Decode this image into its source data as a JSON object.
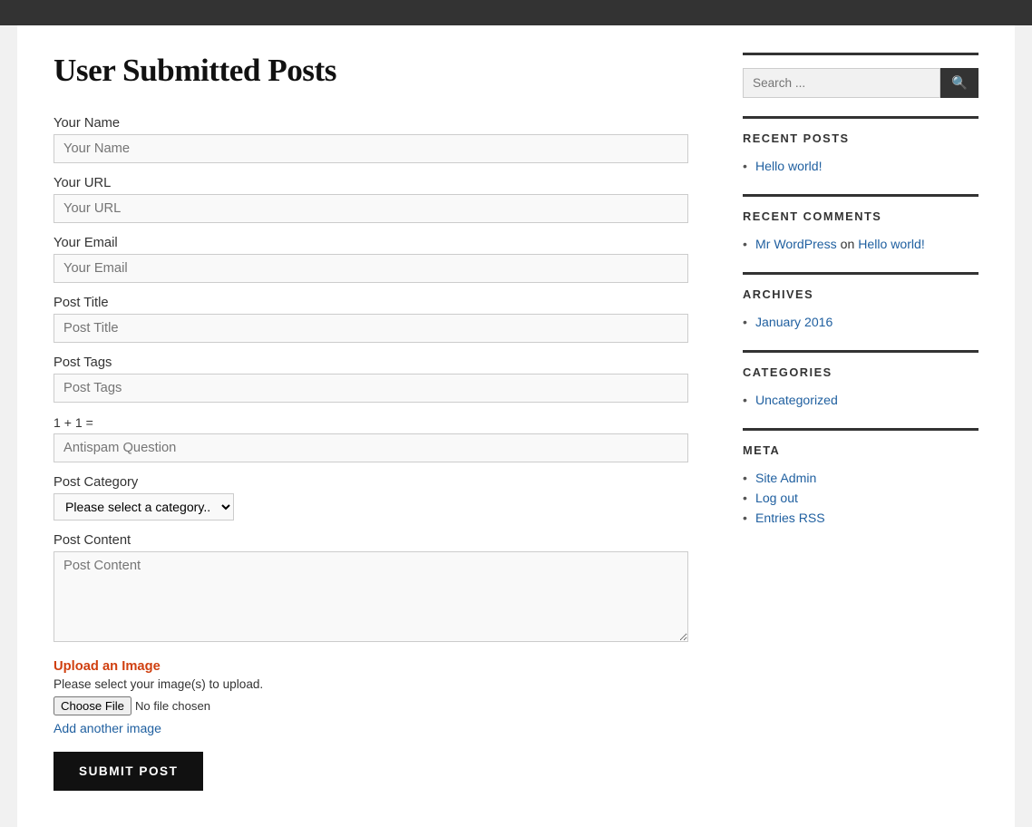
{
  "page": {
    "title": "User Submitted Posts"
  },
  "topbar": {},
  "form": {
    "name_label": "Your Name",
    "name_placeholder": "Your Name",
    "url_label": "Your URL",
    "url_placeholder": "Your URL",
    "email_label": "Your Email",
    "email_placeholder": "Your Email",
    "post_title_label": "Post Title",
    "post_title_placeholder": "Post Title",
    "post_tags_label": "Post Tags",
    "post_tags_placeholder": "Post Tags",
    "antispam_label": "1 + 1 =",
    "antispam_placeholder": "Antispam Question",
    "category_label": "Post Category",
    "category_placeholder": "Please select a category..",
    "content_label": "Post Content",
    "content_placeholder": "Post Content",
    "upload_title": "Upload an Image",
    "upload_desc": "Please select your image(s) to upload.",
    "no_file_text": "No file chosen",
    "add_another_label": "Add another image",
    "submit_label": "SUBMIT POST"
  },
  "sidebar": {
    "search_placeholder": "Search ...",
    "search_button_label": "Search",
    "recent_posts_title": "RECENT POSTS",
    "recent_posts": [
      {
        "label": "Hello world!",
        "url": "#"
      }
    ],
    "recent_comments_title": "RECENT COMMENTS",
    "recent_comments": [
      {
        "author": "Mr WordPress",
        "author_url": "#",
        "on_text": "on",
        "post": "Hello world!",
        "post_url": "#"
      }
    ],
    "archives_title": "ARCHIVES",
    "archives": [
      {
        "label": "January 2016",
        "url": "#"
      }
    ],
    "categories_title": "CATEGORIES",
    "categories": [
      {
        "label": "Uncategorized",
        "url": "#"
      }
    ],
    "meta_title": "META",
    "meta_links": [
      {
        "label": "Site Admin",
        "url": "#"
      },
      {
        "label": "Log out",
        "url": "#"
      },
      {
        "label": "Entries RSS",
        "url": "#"
      }
    ]
  }
}
